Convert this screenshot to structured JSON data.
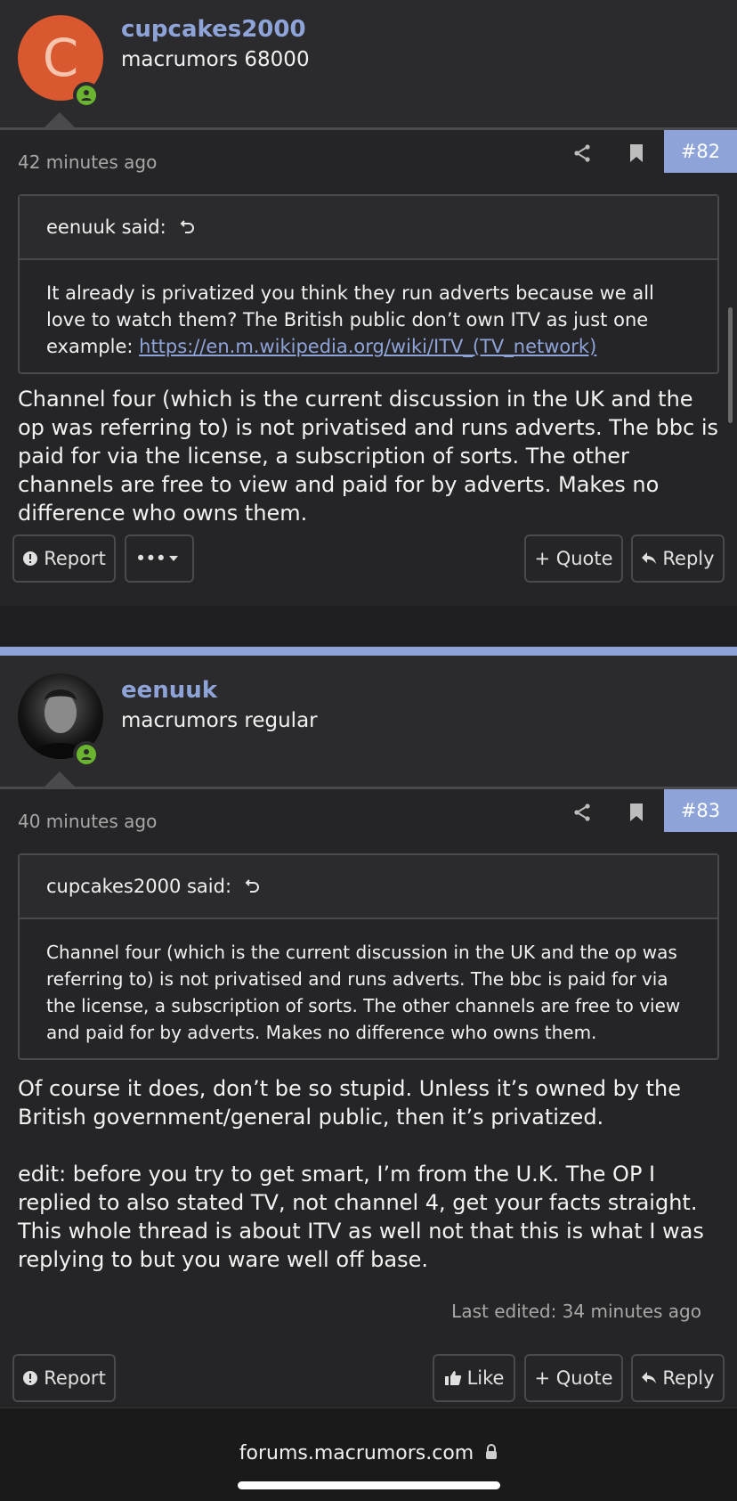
{
  "posts": [
    {
      "username": "cupcakes2000",
      "user_title": "macrumors 68000",
      "avatar_letter": "C",
      "time": "42 minutes ago",
      "post_number": "#82",
      "quote": {
        "author": "eenuuk said:",
        "text": "It already is privatized you think they run adverts because we all love to watch them? The British public don’t own ITV as just one example: ",
        "link": "https://en.m.wikipedia.org/wiki/ITV_(TV_network)"
      },
      "message": [
        "Channel four (which is the current discussion in the UK and the op was referring to) is not privatised and runs adverts. The bbc is paid for via the license, a subscription of sorts. The other channels are free to view and paid for by adverts. Makes no difference who owns them."
      ],
      "buttons": {
        "report": "Report",
        "more": "•••",
        "quote": "+ Quote",
        "reply": "Reply"
      }
    },
    {
      "username": "eenuuk",
      "user_title": "macrumors regular",
      "time": "40 minutes ago",
      "post_number": "#83",
      "quote": {
        "author": "cupcakes2000 said:",
        "text": "Channel four (which is the current discussion in the UK and the op was referring to) is not privatised and runs adverts. The bbc is paid for via the license, a subscription of sorts. The other channels are free to view and paid for by adverts. Makes no difference who owns them."
      },
      "message": [
        "Of course it does, don’t be so stupid. Unless it’s owned by the British government/general public, then it’s privatized.",
        "edit: before you try to get smart, I’m from the U.K. The OP I replied to also stated TV, not channel 4, get your facts straight. This whole thread is about ITV as well not that this is what I was replying to but you ware well off base."
      ],
      "last_edited": "Last edited: 34 minutes ago",
      "buttons": {
        "report": "Report",
        "like": "Like",
        "quote": "+ Quote",
        "reply": "Reply"
      }
    }
  ],
  "browser": {
    "url": "forums.macrumors.com"
  },
  "colors": {
    "accent": "#8ea4d9",
    "online": "#6ab42f",
    "avatar_bg": "#d9582f"
  }
}
